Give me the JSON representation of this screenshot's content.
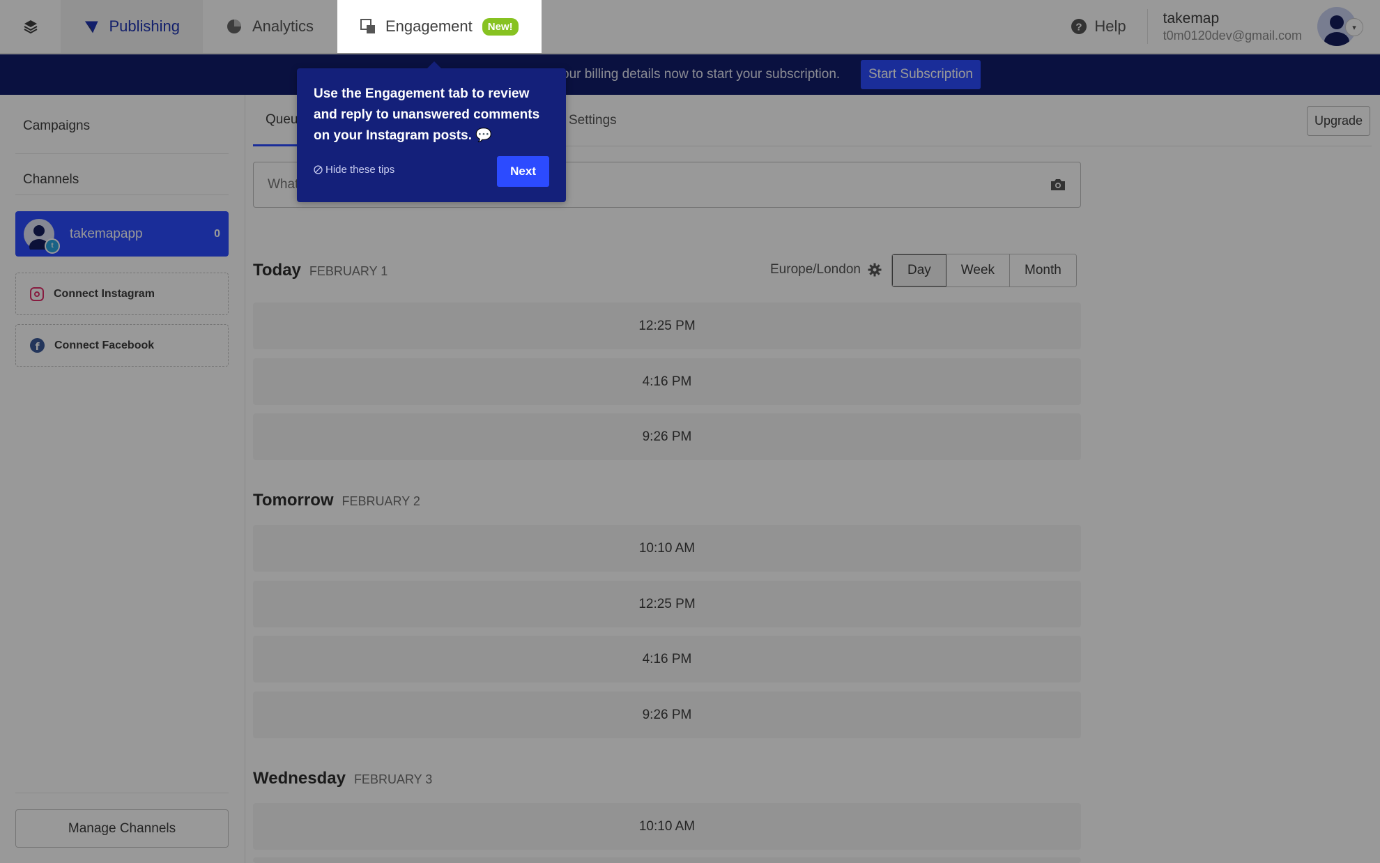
{
  "nav": {
    "logo_icon": "layers-icon",
    "tabs": [
      {
        "label": "Publishing",
        "icon": "publishing-icon"
      },
      {
        "label": "Analytics",
        "icon": "pie-chart-icon"
      },
      {
        "label": "Engagement",
        "icon": "engagement-icon",
        "badge": "New!"
      }
    ],
    "help_label": "Help",
    "account_name": "takemap",
    "account_email": "t0m0120dev@gmail.com"
  },
  "banner": {
    "text": "our billing details now to start your subscription.",
    "button_label": "Start Subscription"
  },
  "tooltip": {
    "text": "Use the Engagement tab to review and reply to unanswered comments on your Instagram posts. 💬",
    "hide_label": "Hide these tips",
    "next_label": "Next"
  },
  "sidebar": {
    "campaigns_label": "Campaigns",
    "channels_label": "Channels",
    "active_channel": {
      "name": "takemapapp",
      "count": "0"
    },
    "connect_instagram": "Connect Instagram",
    "connect_facebook": "Connect Facebook",
    "manage_label": "Manage Channels"
  },
  "main": {
    "tab_queue": "Queu",
    "tab_settings": "Settings",
    "upgrade_label": "Upgrade",
    "composer_placeholder": "What",
    "timezone": "Europe/London",
    "views": [
      "Day",
      "Week",
      "Month"
    ],
    "days": [
      {
        "name": "Today",
        "date": "FEBRUARY 1",
        "slots": [
          "12:25 PM",
          "4:16 PM",
          "9:26 PM"
        ]
      },
      {
        "name": "Tomorrow",
        "date": "FEBRUARY 2",
        "slots": [
          "10:10 AM",
          "12:25 PM",
          "4:16 PM",
          "9:26 PM"
        ]
      },
      {
        "name": "Wednesday",
        "date": "FEBRUARY 3",
        "slots": [
          "10:10 AM"
        ]
      }
    ]
  },
  "colors": {
    "brand_blue": "#2c4bff",
    "banner_navy": "#121d6b",
    "tooltip_navy": "#14207a",
    "badge_green": "#87c221"
  }
}
